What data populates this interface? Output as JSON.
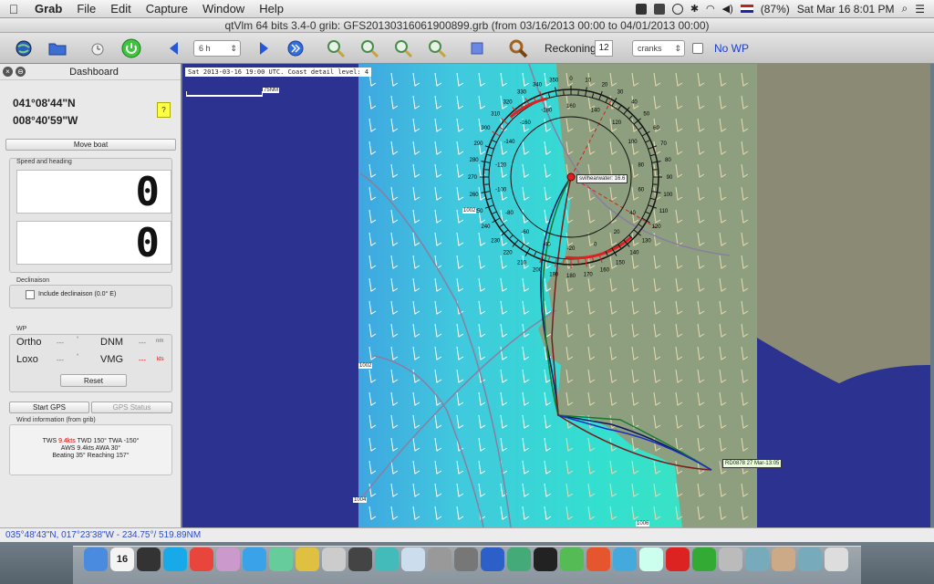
{
  "menubar": {
    "app": "Grab",
    "items": [
      "File",
      "Edit",
      "Capture",
      "Window",
      "Help"
    ],
    "battery": "(87%)",
    "clock": "Sat Mar 16  8:01 PM"
  },
  "window": {
    "title": "qtVlm 64 bits 3.4-0 grib: GFS20130316061900899.grb (from 03/16/2013 00:00 to 04/01/2013 00:00)"
  },
  "toolbar": {
    "interval": "6 h",
    "reckoning_label": "Reckoning",
    "reckoning_value": "12",
    "reckoning_mode": "cranks",
    "no_wp_label": "No WP"
  },
  "dashboard": {
    "title": "Dashboard",
    "latitude": "041°08'44\"N",
    "longitude": "008°40'59\"W",
    "help": "?",
    "move_boat": "Move boat",
    "speed_heading_label": "Speed and heading",
    "speed_value": "0",
    "heading_value": "0",
    "declinaison_label": "Declinaison",
    "include_declinaison": "Include declinaison (0.0° E)",
    "wp_label": "WP",
    "ortho": "Ortho",
    "ortho_value": "---",
    "ortho_unit": "°",
    "dnm": "DNM",
    "dnm_value": "---",
    "dnm_unit": "nm",
    "loxo": "Loxo",
    "loxo_value": "---",
    "loxo_unit": "°",
    "vmg": "VMG",
    "vmg_value": "---",
    "vmg_unit": "kts",
    "reset": "Reset",
    "start_gps": "Start GPS",
    "gps_status": "GPS Status",
    "wind_info_label": "Wind information (from grib)",
    "wind_line1_a": "TWS ",
    "wind_line1_tws": "9.4kts",
    "wind_line1_b": " TWD 150° TWA -150°",
    "wind_line2": "AWS 9.4kts AWA 30°",
    "wind_line3": "Beating 35° Reaching 157°"
  },
  "map": {
    "header": "Sat 2013-03-16 19:00 UTC. Coast detail level: 4",
    "scale": "75NM",
    "boat_label": "svilhearwater: 16.6",
    "target_label": "RD0878 27 Mar-13:05",
    "isobars": [
      "1002",
      "1002",
      "1004",
      "1006"
    ],
    "compass_outer": [
      "0",
      "10",
      "20",
      "30",
      "40",
      "50",
      "60",
      "70",
      "80",
      "90",
      "100",
      "110",
      "120",
      "130",
      "140",
      "150",
      "160",
      "170",
      "180",
      "190",
      "200",
      "210",
      "220",
      "230",
      "240",
      "250",
      "260",
      "270",
      "280",
      "290",
      "300",
      "310",
      "320",
      "330",
      "340",
      "350"
    ],
    "compass_inner": [
      "-140",
      "-160",
      "-180",
      "160",
      "140",
      "120",
      "100",
      "80",
      "60",
      "40",
      "20",
      "0",
      "-20",
      "-40",
      "-60",
      "-80",
      "-100",
      "-120"
    ],
    "colors": {
      "sea": "#2b3290",
      "wind_low": "#4fd8c9",
      "wind_high": "#2ee0d0",
      "land": "#8aa286",
      "land_beige": "#c9ba90",
      "route_red": "#cc2222"
    }
  },
  "statusbar": {
    "text": "035°48'43\"N, 017°23'38\"W - 234.75°/ 519.89NM"
  },
  "dock": {
    "calendar_day": "16",
    "icons": [
      "finder-icon",
      "calendar-icon",
      "dashboard-icon",
      "skype-icon",
      "chrome-icon",
      "photobooth-icon",
      "itunes-icon",
      "iphoto-icon",
      "star-icon",
      "preview-icon",
      "dictionary-icon",
      "ship-icon",
      "boat-icon",
      "calculator-icon",
      "system-prefs-icon",
      "word-icon",
      "earth-icon",
      "x11-icon",
      "evernote-icon",
      "office-icon",
      "quick-icon",
      "folder-icon",
      "red-star-icon",
      "green-icon",
      "utility-icon",
      "applications-folder-icon",
      "documents-folder-icon",
      "downloads-folder-icon",
      "trash-icon"
    ]
  }
}
